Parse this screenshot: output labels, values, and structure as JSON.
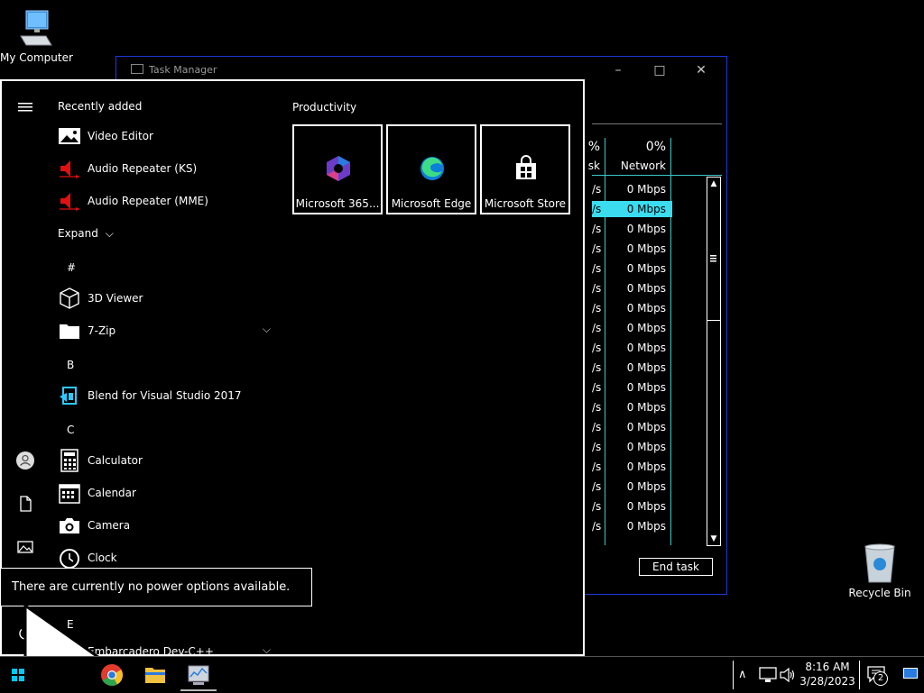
{
  "desktop": {
    "my_computer_label": "My Computer",
    "recycle_bin_label": "Recycle Bin"
  },
  "task_manager": {
    "title": "Task Manager",
    "disk_header_pct": "%",
    "disk_header_label": "sk",
    "network_header_pct": "0%",
    "network_header_label": "Network",
    "disk_cell": "/s",
    "rows": [
      "0 Mbps",
      "0 Mbps",
      "0 Mbps",
      "0 Mbps",
      "0 Mbps",
      "0 Mbps",
      "0 Mbps",
      "0 Mbps",
      "0 Mbps",
      "0 Mbps",
      "0 Mbps",
      "0 Mbps",
      "0 Mbps",
      "0 Mbps",
      "0 Mbps",
      "0 Mbps",
      "0 Mbps",
      "0 Mbps"
    ],
    "selected_row": 1,
    "end_task_label": "End task"
  },
  "start_menu": {
    "recently_added": "Recently added",
    "recent_apps": [
      "Video Editor",
      "Audio Repeater (KS)",
      "Audio Repeater (MME)"
    ],
    "expand_label": "Expand",
    "sections": [
      {
        "letter": "#",
        "apps": [
          "3D Viewer",
          "7-Zip"
        ]
      },
      {
        "letter": "B",
        "apps": [
          "Blend for Visual Studio 2017"
        ]
      },
      {
        "letter": "C",
        "apps": [
          "Calculator",
          "Calendar",
          "Camera",
          "Clock"
        ]
      },
      {
        "letter": "E",
        "apps": [
          "Embarcadero Dev-C++"
        ]
      }
    ],
    "productivity_label": "Productivity",
    "tiles": [
      "Microsoft 365...",
      "Microsoft Edge",
      "Microsoft Store"
    ]
  },
  "power_tooltip": "There are currently no power options available.",
  "taskbar": {
    "time": "8:16 AM",
    "date": "3/28/2023",
    "notification_count": "2"
  },
  "colors": {
    "accent_cyan": "#00c8ff",
    "selection": "#3cdcf0",
    "window_border": "#1a3bd8"
  }
}
